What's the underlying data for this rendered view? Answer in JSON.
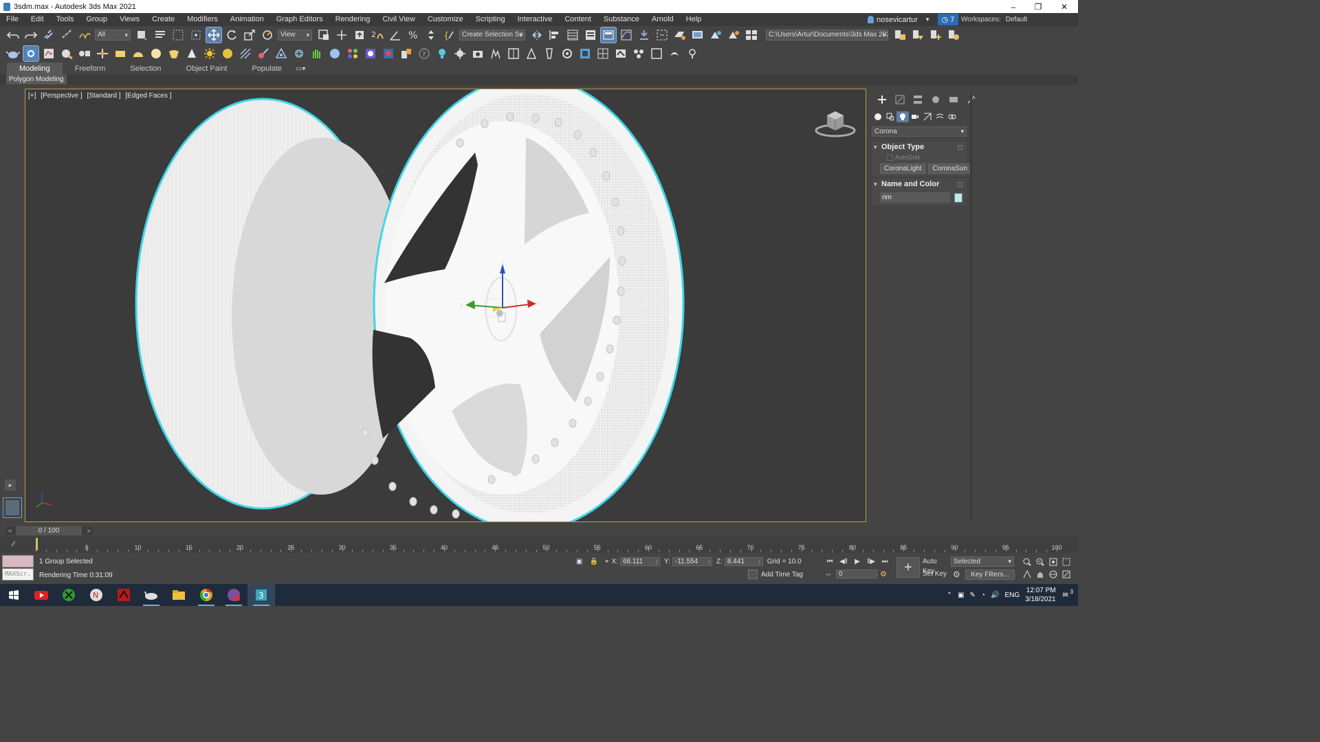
{
  "window": {
    "title": "3sdm.max - Autodesk 3ds Max 2021",
    "minimize": "–",
    "restore": "❐",
    "close": "✕"
  },
  "menu": [
    "File",
    "Edit",
    "Tools",
    "Group",
    "Views",
    "Create",
    "Modifiers",
    "Animation",
    "Graph Editors",
    "Rendering",
    "Civil View",
    "Customize",
    "Scripting",
    "Interactive",
    "Content",
    "Substance",
    "Arnold",
    "Help"
  ],
  "user": {
    "name": "nosevicartur",
    "clock_count": "7",
    "workspaces_label": "Workspaces:",
    "workspace": "Default"
  },
  "toolbar": {
    "filter": "All",
    "ref_coord": "View",
    "selection_set": "Create Selection Se",
    "path": "C:\\Users\\Artur\\Documents\\3ds Max 2021"
  },
  "ribbon": {
    "tabs": [
      "Modeling",
      "Freeform",
      "Selection",
      "Object Paint",
      "Populate"
    ],
    "panel": "Polygon Modeling"
  },
  "viewport": {
    "labels": [
      "[+]",
      "[Perspective ]",
      "[Standard ]",
      "[Edged Faces ]"
    ],
    "gizmo": {
      "x": "x",
      "y": "y",
      "z": "z"
    }
  },
  "command_panel": {
    "renderer": "Corona",
    "object_type": {
      "title": "Object Type",
      "autogrid": "AutoGrid",
      "buttons": [
        "CoronaLight",
        "CoronaSun"
      ]
    },
    "name_and_color": {
      "title": "Name and Color",
      "name": "rim",
      "color": "#bfe6f1"
    }
  },
  "timeline": {
    "frame": "0 / 100",
    "ticks": [
      "5",
      "10",
      "15",
      "20",
      "25",
      "30",
      "35",
      "40",
      "45",
      "50",
      "55",
      "60",
      "65",
      "70",
      "75",
      "80",
      "85",
      "90",
      "95",
      "100"
    ]
  },
  "status": {
    "selection": "1 Group Selected",
    "render_time": "Rendering Time  0:31:09",
    "maxscript": "MAXScr."
  },
  "coords": {
    "x_label": "X:",
    "x": "68.111",
    "y_label": "Y:",
    "y": "-11.554",
    "z_label": "Z:",
    "z": "8.441",
    "grid": "Grid = 10.0"
  },
  "add_time_tag": "Add Time Tag",
  "anim": {
    "frame_field": "0",
    "auto_key": "Auto Key",
    "set_key": "Set Key",
    "selected": "Selected",
    "key_filters": "Key Filters..."
  },
  "taskbar": {
    "lang": "ENG",
    "time": "12:07 PM",
    "date": "3/18/2021",
    "notif": "3"
  },
  "colors": {
    "accent": "#5d7ea6",
    "viewport_border": "#b8a04a",
    "selection_outline": "#35d4e6",
    "taskbar": "#1f2a3a"
  }
}
